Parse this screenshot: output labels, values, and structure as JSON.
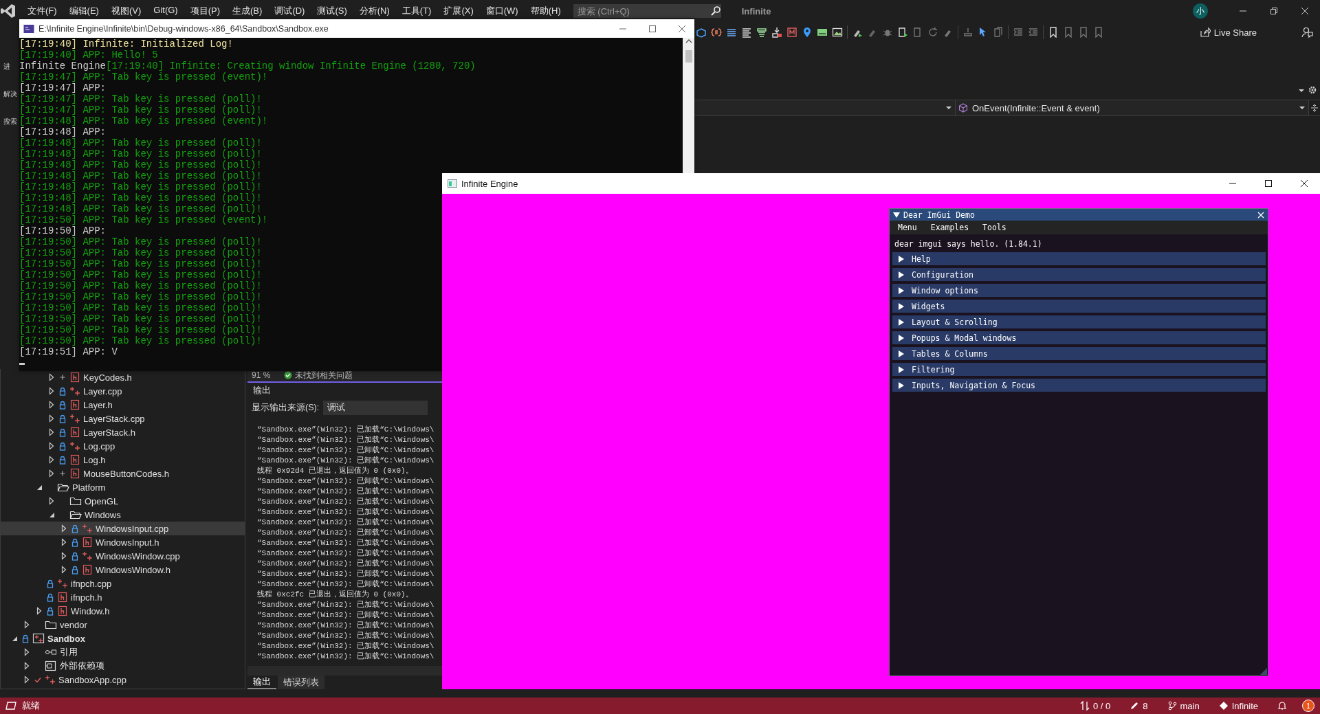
{
  "vs": {
    "menu": [
      "文件(F)",
      "编辑(E)",
      "视图(V)",
      "Git(G)",
      "项目(P)",
      "生成(B)",
      "调试(D)",
      "测试(S)",
      "分析(N)",
      "工具(T)",
      "扩展(X)",
      "窗口(W)",
      "帮助(H)"
    ],
    "search": {
      "placeholder": "搜索 (Ctrl+Q)"
    },
    "solution_name": "Infinite",
    "avatar": "小",
    "live_share": "Live Share",
    "strip": [
      "进",
      "解决",
      "搜索"
    ],
    "function_dropdown": "OnEvent(Infinite::Event & event)"
  },
  "solution_explorer": {
    "tree": [
      {
        "children": [
          {
            "children": [
              {
                "children": [
                  {
                    "label": "KeyCodes.h",
                    "kind": "header",
                    "locked": false,
                    "added": true,
                    "checked_out": false,
                    "expanded": false,
                    "selected": false
                  },
                  {
                    "label": "Layer.cpp",
                    "kind": "source",
                    "locked": true,
                    "added": false,
                    "checked_out": false,
                    "expanded": false,
                    "selected": false
                  },
                  {
                    "label": "Layer.h",
                    "kind": "header",
                    "locked": true,
                    "added": false,
                    "checked_out": false,
                    "expanded": false,
                    "selected": false
                  },
                  {
                    "label": "LayerStack.cpp",
                    "kind": "source",
                    "locked": true,
                    "added": false,
                    "checked_out": false,
                    "expanded": false,
                    "selected": false
                  },
                  {
                    "label": "LayerStack.h",
                    "kind": "header",
                    "locked": true,
                    "added": false,
                    "checked_out": false,
                    "expanded": false,
                    "selected": false
                  },
                  {
                    "label": "Log.cpp",
                    "kind": "source",
                    "locked": true,
                    "added": false,
                    "checked_out": false,
                    "expanded": false,
                    "selected": false
                  },
                  {
                    "label": "Log.h",
                    "kind": "header",
                    "locked": true,
                    "added": false,
                    "checked_out": false,
                    "expanded": false,
                    "selected": false
                  },
                  {
                    "label": "MouseButtonCodes.h",
                    "kind": "header",
                    "locked": false,
                    "added": true,
                    "checked_out": false,
                    "expanded": false,
                    "selected": false
                  }
                ]
              },
              {
                "label": "Platform",
                "kind": "folder",
                "locked": false,
                "added": false,
                "checked_out": false,
                "expanded": true,
                "selected": false,
                "children": [
                  {
                    "label": "OpenGL",
                    "kind": "folder",
                    "locked": false,
                    "added": false,
                    "checked_out": false,
                    "expanded": false,
                    "selected": false
                  },
                  {
                    "label": "Windows",
                    "kind": "folder",
                    "locked": false,
                    "added": false,
                    "checked_out": false,
                    "expanded": true,
                    "selected": false,
                    "children": [
                      {
                        "label": "WindowsInput.cpp",
                        "kind": "source",
                        "locked": true,
                        "added": false,
                        "checked_out": false,
                        "expanded": false,
                        "selected": true
                      },
                      {
                        "label": "WindowsInput.h",
                        "kind": "header",
                        "locked": true,
                        "added": false,
                        "checked_out": false,
                        "expanded": false,
                        "selected": false
                      },
                      {
                        "label": "WindowsWindow.cpp",
                        "kind": "source",
                        "locked": true,
                        "added": false,
                        "checked_out": false,
                        "expanded": false,
                        "selected": false
                      },
                      {
                        "label": "WindowsWindow.h",
                        "kind": "header",
                        "locked": true,
                        "added": false,
                        "checked_out": false,
                        "expanded": false,
                        "selected": false
                      }
                    ]
                  }
                ]
              },
              {
                "label": "ifnpch.cpp",
                "kind": "source",
                "locked": true,
                "added": false,
                "checked_out": false,
                "selected": false
              },
              {
                "label": "ifnpch.h",
                "kind": "header",
                "locked": true,
                "added": false,
                "checked_out": false,
                "selected": false
              },
              {
                "label": "Window.h",
                "kind": "header",
                "locked": true,
                "added": false,
                "checked_out": false,
                "expanded": false,
                "selected": false
              }
            ]
          },
          {
            "label": "vendor",
            "kind": "folder",
            "locked": false,
            "added": false,
            "checked_out": false,
            "expanded": false,
            "selected": false
          }
        ]
      },
      {
        "label": "Sandbox",
        "kind": "project",
        "locked": true,
        "added": false,
        "checked_out": false,
        "expanded": true,
        "selected": false,
        "children": [
          {
            "label": "引用",
            "kind": "references",
            "locked": false,
            "added": false,
            "checked_out": false,
            "expanded": false,
            "selected": false
          },
          {
            "label": "外部依赖项",
            "kind": "external",
            "locked": false,
            "added": false,
            "checked_out": false,
            "expanded": false,
            "selected": false
          },
          {
            "label": "SandboxApp.cpp",
            "kind": "source",
            "locked": false,
            "added": false,
            "checked_out": true,
            "expanded": false,
            "selected": false
          }
        ]
      }
    ]
  },
  "output": {
    "zoom": "91 %",
    "issues": "未找到相关问题",
    "title": "输出",
    "source_label": "显示输出来源(S):",
    "source": "调试",
    "lines": [
      "“Sandbox.exe”(Win32): 已加载“C:\\Windows\\",
      "“Sandbox.exe”(Win32): 已加载“C:\\Windows\\",
      "“Sandbox.exe”(Win32): 已卸载“C:\\Windows\\",
      "“Sandbox.exe”(Win32): 已卸载“C:\\Windows\\",
      "线程 0x92d4 已退出，返回值为 0 (0x0)。",
      "“Sandbox.exe”(Win32): 已卸载“C:\\Windows\\",
      "“Sandbox.exe”(Win32): 已加载“C:\\Windows\\",
      "“Sandbox.exe”(Win32): 已加载“C:\\Windows\\",
      "“Sandbox.exe”(Win32): 已加载“C:\\Windows\\",
      "“Sandbox.exe”(Win32): 已加载“C:\\Windows\\",
      "“Sandbox.exe”(Win32): 已卸载“C:\\Windows\\",
      "“Sandbox.exe”(Win32): 已加载“C:\\Windows\\",
      "“Sandbox.exe”(Win32): 已加载“C:\\Windows\\",
      "“Sandbox.exe”(Win32): 已加载“C:\\Windows\\",
      "“Sandbox.exe”(Win32): 已卸载“C:\\Windows\\",
      "“Sandbox.exe”(Win32): 已卸载“C:\\Windows\\",
      "线程 0xc2fc 已退出，返回值为 0 (0x0)。",
      "“Sandbox.exe”(Win32): 已加载“C:\\Windows\\",
      "“Sandbox.exe”(Win32): 已卸载“C:\\Windows\\",
      "“Sandbox.exe”(Win32): 已加载“C:\\Windows\\",
      "“Sandbox.exe”(Win32): 已加载“C:\\Windows\\",
      "“Sandbox.exe”(Win32): 已加载“C:\\Windows\\",
      "“Sandbox.exe”(Win32): 已加载“C:\\Windows\\"
    ],
    "tabs": [
      {
        "label": "输出",
        "selected": true
      },
      {
        "label": "错误列表",
        "selected": false
      }
    ]
  },
  "status_bar": {
    "text": "就绪",
    "changes": "0 / 0",
    "edits": "8",
    "branch": "main",
    "repo": "Infinite",
    "notifications": "1"
  },
  "console": {
    "title": "E:\\Infinite Engine\\Infinite\\bin\\Debug-windows-x86_64\\Sandbox\\Sandbox.exe",
    "lines": [
      {
        "kind": "warn",
        "text": "[17:19:40] Infinite: Initialized Log!"
      },
      {
        "kind": "info",
        "text": "[17:19:40] APP: Hello! 5"
      },
      {
        "kind": "info",
        "prefix": "Infinite Engine",
        "text": "[17:19:40] Infinite: Creating window Infinite Engine (1280, 720)"
      },
      {
        "kind": "info",
        "text": "[17:19:47] APP: Tab key is pressed (event)!"
      },
      {
        "kind": "trace",
        "text": "[17:19:47] APP:"
      },
      {
        "kind": "info",
        "text": "[17:19:47] APP: Tab key is pressed (poll)!"
      },
      {
        "kind": "info",
        "text": "[17:19:47] APP: Tab key is pressed (poll)!"
      },
      {
        "kind": "info",
        "text": "[17:19:48] APP: Tab key is pressed (event)!"
      },
      {
        "kind": "trace",
        "text": "[17:19:48] APP:"
      },
      {
        "kind": "info",
        "text": "[17:19:48] APP: Tab key is pressed (poll)!"
      },
      {
        "kind": "info",
        "text": "[17:19:48] APP: Tab key is pressed (poll)!"
      },
      {
        "kind": "info",
        "text": "[17:19:48] APP: Tab key is pressed (poll)!"
      },
      {
        "kind": "info",
        "text": "[17:19:48] APP: Tab key is pressed (poll)!"
      },
      {
        "kind": "info",
        "text": "[17:19:48] APP: Tab key is pressed (poll)!"
      },
      {
        "kind": "info",
        "text": "[17:19:48] APP: Tab key is pressed (poll)!"
      },
      {
        "kind": "info",
        "text": "[17:19:48] APP: Tab key is pressed (poll)!"
      },
      {
        "kind": "info",
        "text": "[17:19:50] APP: Tab key is pressed (event)!"
      },
      {
        "kind": "trace",
        "text": "[17:19:50] APP:"
      },
      {
        "kind": "info",
        "text": "[17:19:50] APP: Tab key is pressed (poll)!"
      },
      {
        "kind": "info",
        "text": "[17:19:50] APP: Tab key is pressed (poll)!"
      },
      {
        "kind": "info",
        "text": "[17:19:50] APP: Tab key is pressed (poll)!"
      },
      {
        "kind": "info",
        "text": "[17:19:50] APP: Tab key is pressed (poll)!"
      },
      {
        "kind": "info",
        "text": "[17:19:50] APP: Tab key is pressed (poll)!"
      },
      {
        "kind": "info",
        "text": "[17:19:50] APP: Tab key is pressed (poll)!"
      },
      {
        "kind": "info",
        "text": "[17:19:50] APP: Tab key is pressed (poll)!"
      },
      {
        "kind": "info",
        "text": "[17:19:50] APP: Tab key is pressed (poll)!"
      },
      {
        "kind": "info",
        "text": "[17:19:50] APP: Tab key is pressed (poll)!"
      },
      {
        "kind": "info",
        "text": "[17:19:50] APP: Tab key is pressed (poll)!"
      },
      {
        "kind": "trace",
        "text": "[17:19:51] APP: V"
      }
    ]
  },
  "engine_window": {
    "title": "Infinite Engine",
    "imgui": {
      "title": "Dear ImGui Demo",
      "menu": [
        "Menu",
        "Examples",
        "Tools"
      ],
      "text": "dear imgui says hello. (1.84.1)",
      "headers": [
        {
          "label": "Help",
          "expanded": false
        },
        {
          "label": "Configuration",
          "expanded": false
        },
        {
          "label": "Window options",
          "expanded": false
        },
        {
          "label": "Widgets",
          "expanded": false
        },
        {
          "label": "Layout & Scrolling",
          "expanded": false
        },
        {
          "label": "Popups & Modal windows",
          "expanded": false
        },
        {
          "label": "Tables & Columns",
          "expanded": false
        },
        {
          "label": "Filtering",
          "expanded": false
        },
        {
          "label": "Inputs, Navigation & Focus",
          "expanded": false
        }
      ]
    }
  }
}
